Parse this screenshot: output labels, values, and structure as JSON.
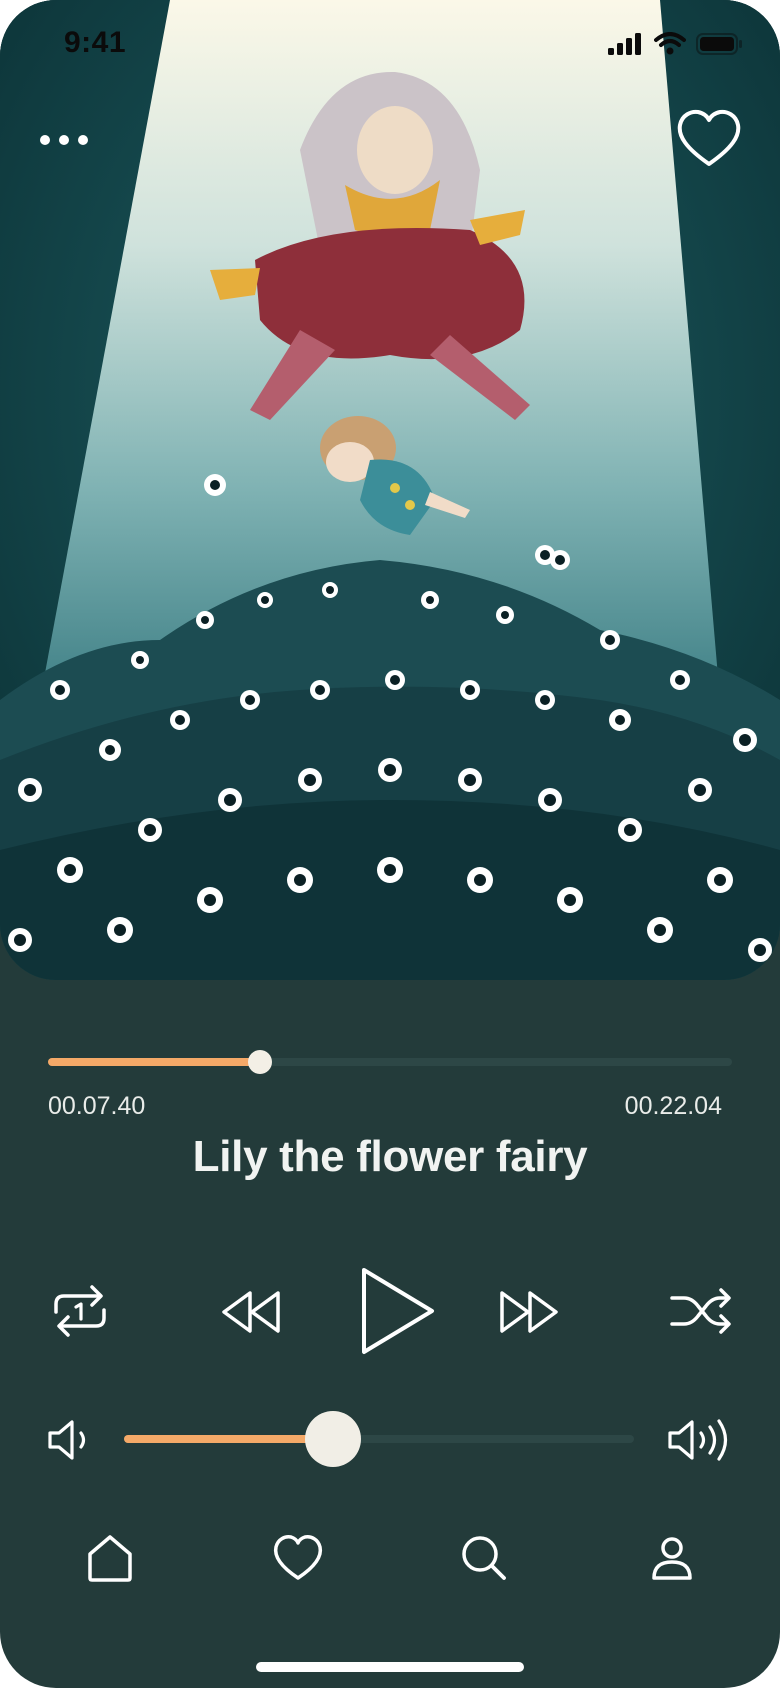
{
  "status_bar": {
    "time": "9:41"
  },
  "player": {
    "title": "Lily the flower fairy",
    "elapsed": "00.07.40",
    "duration": "00.22.04",
    "progress_fraction": 0.31,
    "volume_fraction": 0.41
  },
  "colors": {
    "background": "#233b3a",
    "accent": "#f4a968",
    "track": "#2d4746",
    "foreground": "#ffffff"
  },
  "icons": {
    "more": "more-dots-icon",
    "favorite": "heart-outline-icon",
    "repeat": "repeat-one-icon",
    "rewind": "rewind-icon",
    "play": "play-icon",
    "forward": "fast-forward-icon",
    "shuffle": "shuffle-icon",
    "volume_low": "volume-low-icon",
    "volume_high": "volume-high-icon"
  },
  "tabs": [
    {
      "id": "home",
      "icon": "home-icon"
    },
    {
      "id": "favorites",
      "icon": "heart-icon"
    },
    {
      "id": "search",
      "icon": "search-icon"
    },
    {
      "id": "profile",
      "icon": "user-icon"
    }
  ]
}
